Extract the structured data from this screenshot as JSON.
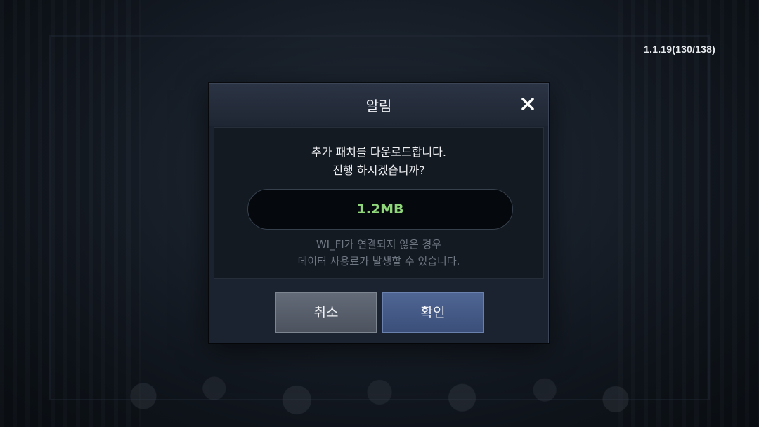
{
  "version": {
    "text": "1.1.19(130/138)"
  },
  "dialog": {
    "title": "알림",
    "close_icon": "close-icon",
    "message_line1": "추가 패치를 다운로드합니다.",
    "message_line2": "진행 하시겠습니까?",
    "download_size": "1.2MB",
    "note_line1": "WI_FI가 연결되지 않은 경우",
    "note_line2": "데이터 사용료가 발생할 수 있습니다.",
    "cancel_label": "취소",
    "confirm_label": "확인"
  },
  "colors": {
    "size_text": "#8fd67b",
    "confirm_button": "#4a5f8c",
    "cancel_button": "#5a616d"
  }
}
